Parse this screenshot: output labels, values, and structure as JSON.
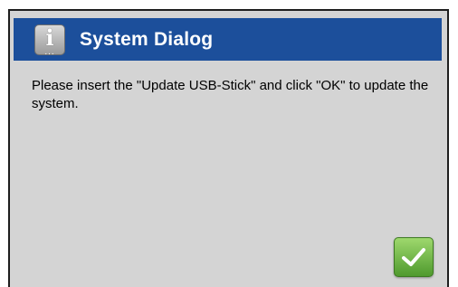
{
  "dialog": {
    "title": "System Dialog",
    "icon": "info-icon",
    "icon_glyph": "i",
    "icon_dots": "...",
    "message": "Please insert the \"Update USB-Stick\" and click \"OK\" to update the system.",
    "ok_button_icon": "checkmark-icon"
  },
  "colors": {
    "titlebar": "#1c4f9b",
    "background": "#d4d4d4",
    "ok_button": "#6cb544"
  }
}
